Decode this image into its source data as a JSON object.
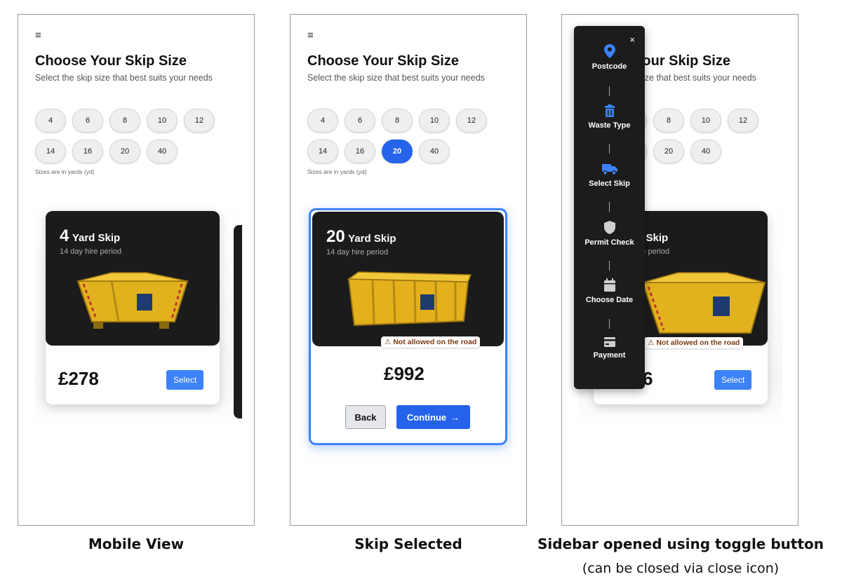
{
  "common": {
    "menu_icon": "≡",
    "title": "Choose Your Skip Size",
    "subtitle": "Select the skip size that best suits your needs",
    "sizes": [
      "4",
      "6",
      "8",
      "10",
      "12",
      "14",
      "16",
      "20",
      "40"
    ],
    "sizes_note": "Sizes are in yards (yd)",
    "yard_skip": "Yard Skip",
    "hire_period": "14 day hire period",
    "select_label": "Select",
    "warning": "Not allowed on the road"
  },
  "panel1": {
    "caption": "Mobile View",
    "card": {
      "size": "4",
      "price": "£278"
    }
  },
  "panel2": {
    "caption": "Skip Selected",
    "selected_size": "20",
    "card": {
      "size": "20",
      "price": "£992"
    },
    "back_label": "Back",
    "continue_label": "Continue",
    "continue_icon": "→"
  },
  "panel3": {
    "caption": "Sidebar opened using toggle button",
    "subcaption": "(can be closed via close icon)",
    "close_icon": "×",
    "price_fragment": "6",
    "steps": [
      {
        "label": "Postcode",
        "icon": "map-pin-icon"
      },
      {
        "label": "Waste Type",
        "icon": "trash-icon"
      },
      {
        "label": "Select Skip",
        "icon": "truck-icon"
      },
      {
        "label": "Permit Check",
        "icon": "shield-icon"
      },
      {
        "label": "Choose Date",
        "icon": "calendar-icon"
      },
      {
        "label": "Payment",
        "icon": "credit-card-icon"
      }
    ]
  },
  "colors": {
    "accent": "#2563eb",
    "select_button": "#3b82f6",
    "card_dark": "#1b1b1b",
    "sidebar": "#1c1c1c",
    "warning_text": "#7a3b12"
  }
}
